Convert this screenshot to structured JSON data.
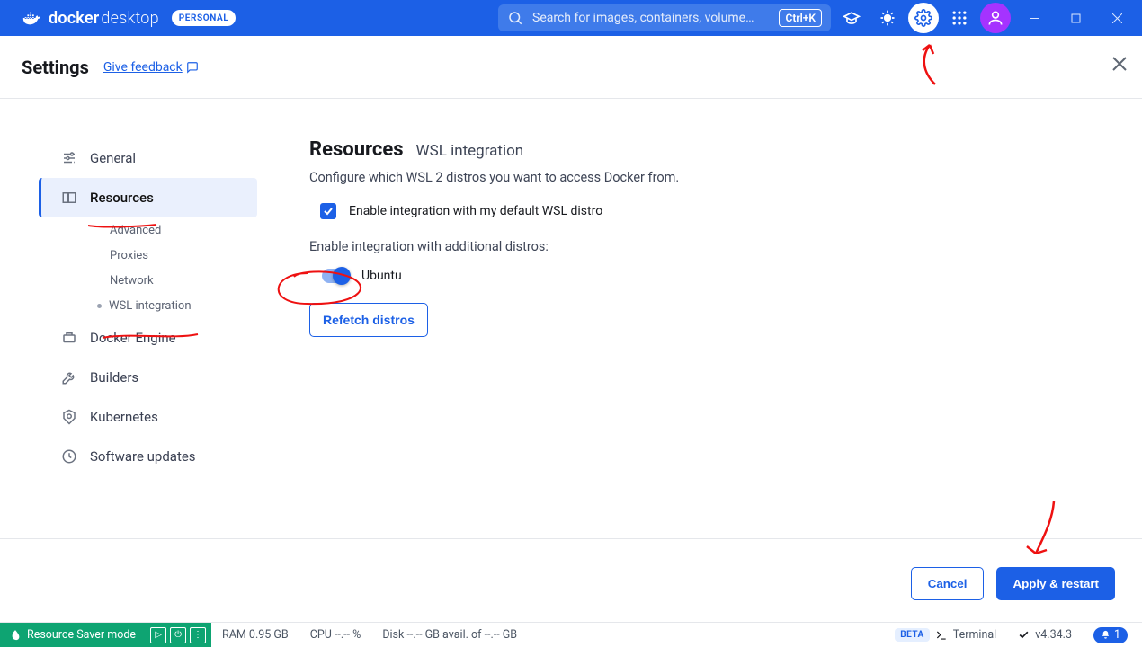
{
  "topbar": {
    "brand_bold": "docker",
    "brand_light": "desktop",
    "badge": "PERSONAL",
    "search_placeholder": "Search for images, containers, volume…",
    "kbd": "Ctrl+K"
  },
  "header": {
    "title": "Settings",
    "feedback": "Give feedback"
  },
  "sidebar": {
    "items": [
      {
        "label": "General"
      },
      {
        "label": "Resources",
        "active": true,
        "sub": [
          {
            "label": "Advanced"
          },
          {
            "label": "Proxies"
          },
          {
            "label": "Network"
          },
          {
            "label": "WSL integration",
            "selected": true
          }
        ]
      },
      {
        "label": "Docker Engine"
      },
      {
        "label": "Builders"
      },
      {
        "label": "Kubernetes"
      },
      {
        "label": "Software updates"
      }
    ]
  },
  "main": {
    "heading": "Resources",
    "subheading": "WSL integration",
    "description": "Configure which WSL 2 distros you want to access Docker from.",
    "default_label": "Enable integration with my default WSL distro",
    "default_checked": true,
    "additional_label": "Enable integration with additional distros:",
    "distros": [
      {
        "name": "Ubuntu",
        "enabled": true
      }
    ],
    "refetch": "Refetch distros"
  },
  "footer": {
    "cancel": "Cancel",
    "apply": "Apply & restart"
  },
  "status": {
    "saver": "Resource Saver mode",
    "ram": "RAM 0.95 GB",
    "cpu": "CPU --.-- %",
    "disk": "Disk --.-- GB avail. of --.-- GB",
    "beta": "BETA",
    "terminal": "Terminal",
    "version": "v4.34.3",
    "notif_count": "1"
  }
}
